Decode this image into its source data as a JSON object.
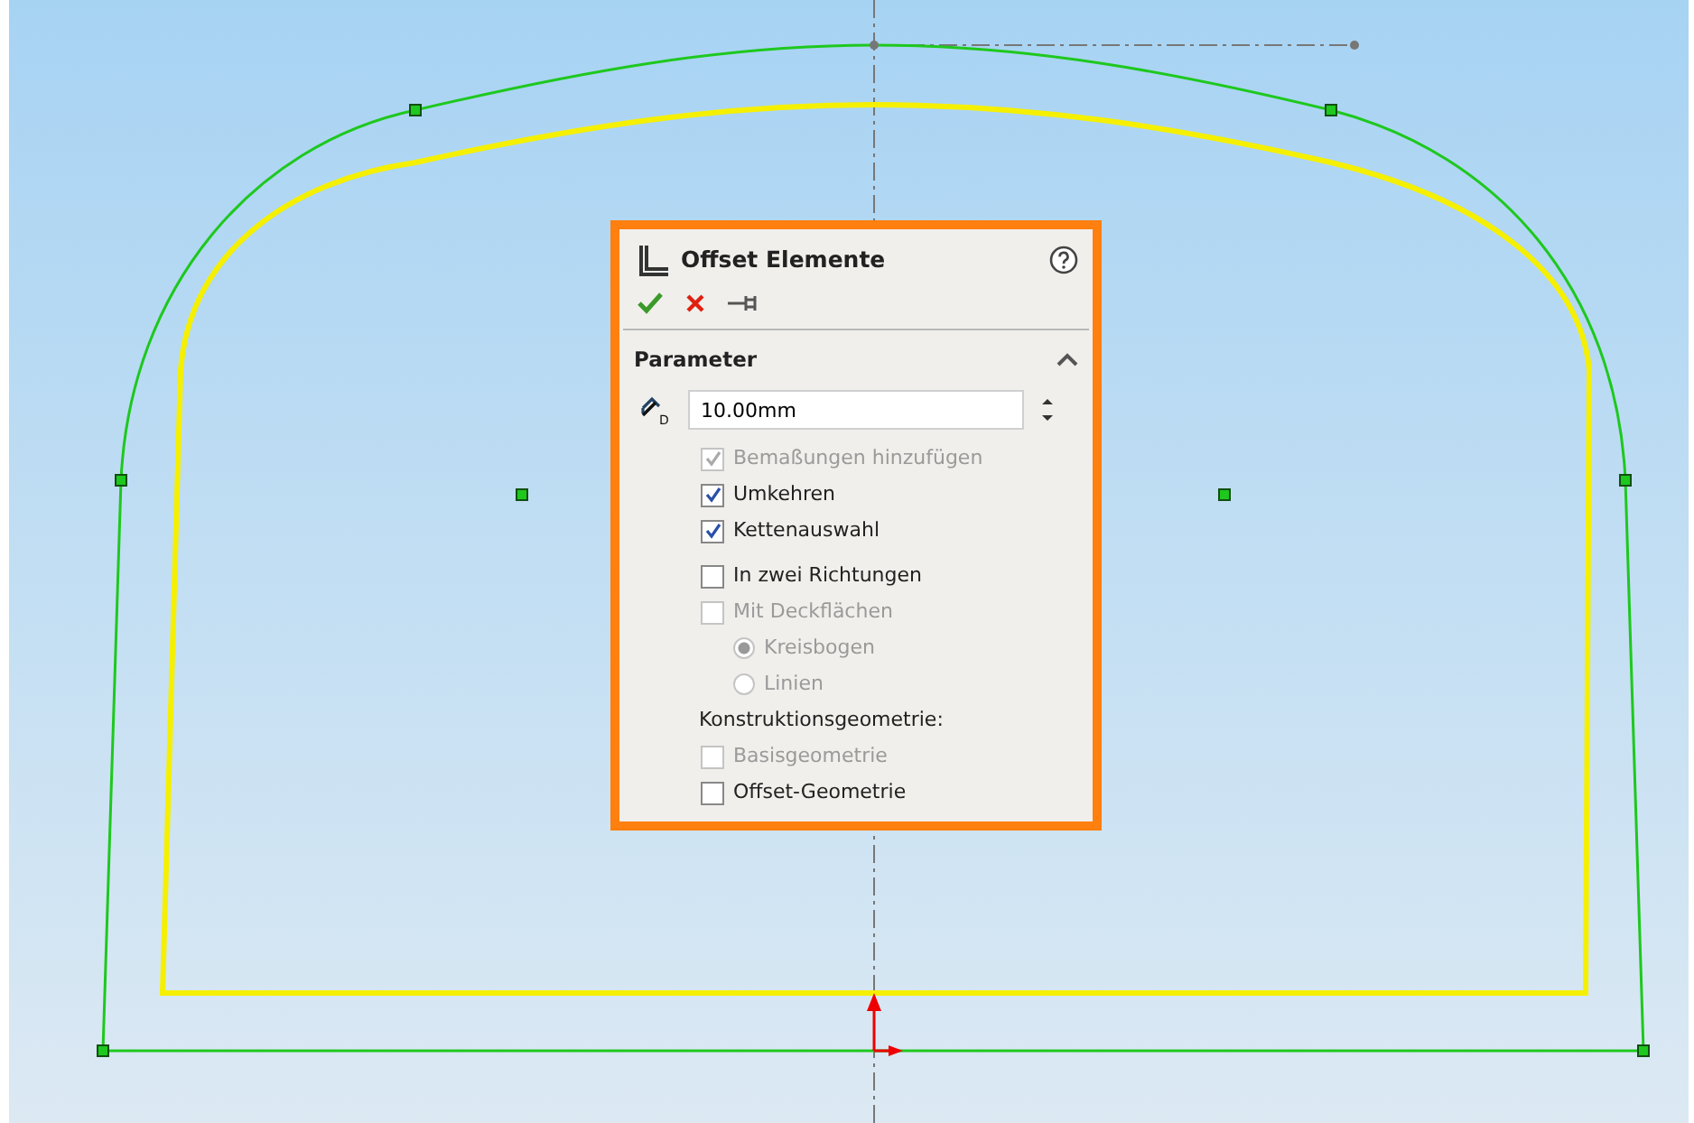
{
  "dialog": {
    "title": "Offset Elemente",
    "section": {
      "title": "Parameter",
      "expanded": true
    },
    "distance": {
      "icon_letter": "D",
      "value": "10.00mm"
    },
    "options": [
      {
        "kind": "checkbox",
        "label": "Bemaßungen hinzufügen",
        "checked": true,
        "disabled": true
      },
      {
        "kind": "checkbox",
        "label": "Umkehren",
        "checked": true,
        "disabled": false
      },
      {
        "kind": "checkbox",
        "label": "Kettenauswahl",
        "checked": true,
        "disabled": false
      },
      {
        "kind": "gap"
      },
      {
        "kind": "checkbox",
        "label": "In zwei Richtungen",
        "checked": false,
        "disabled": false
      },
      {
        "kind": "checkbox",
        "label": "Mit Deckflächen",
        "checked": false,
        "disabled": true
      },
      {
        "kind": "radio",
        "label": "Kreisbogen",
        "selected": true,
        "disabled": true
      },
      {
        "kind": "radio",
        "label": "Linien",
        "selected": false,
        "disabled": true
      },
      {
        "kind": "heading",
        "label": "Konstruktionsgeometrie:"
      },
      {
        "kind": "checkbox",
        "label": "Basisgeometrie",
        "checked": false,
        "disabled": true
      },
      {
        "kind": "checkbox",
        "label": "Offset-Geometrie",
        "checked": false,
        "disabled": false
      }
    ]
  }
}
